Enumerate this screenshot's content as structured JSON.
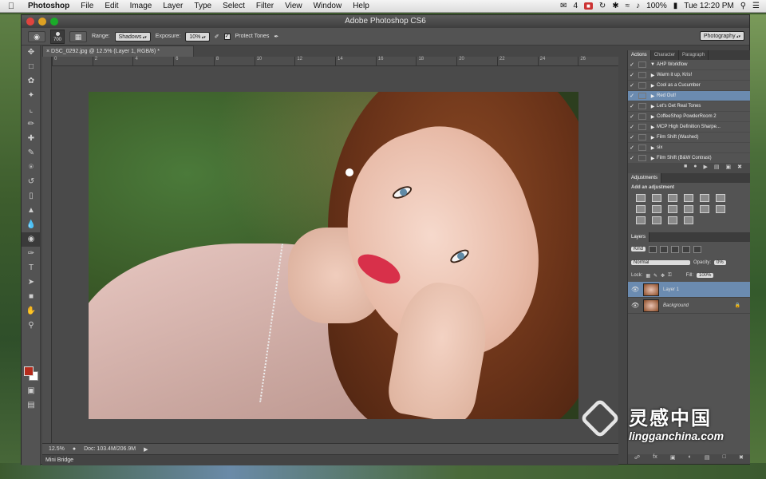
{
  "menubar": {
    "app": "Photoshop",
    "items": [
      "File",
      "Edit",
      "Image",
      "Layer",
      "Type",
      "Select",
      "Filter",
      "View",
      "Window",
      "Help"
    ],
    "status": {
      "count": "4",
      "battery": "100%",
      "clock": "Tue 12:20 PM"
    }
  },
  "window": {
    "title": "Adobe Photoshop CS6"
  },
  "options": {
    "brush_size": "700",
    "range_label": "Range:",
    "range_value": "Shadows",
    "exposure_label": "Exposure:",
    "exposure_value": "10%",
    "protect_tones": "Protect Tones",
    "workspace": "Photography"
  },
  "document": {
    "tab": "DSC_0292.jpg @ 12.5% (Layer 1, RGB/8) *",
    "ruler": [
      "0",
      "2",
      "4",
      "6",
      "8",
      "10",
      "12",
      "14",
      "16",
      "18",
      "20",
      "22",
      "24",
      "26"
    ],
    "zoom": "12.5%",
    "doc_size": "Doc: 103.4M/206.9M"
  },
  "minibridge": "Mini Bridge",
  "actions_panel": {
    "tabs": [
      "Actions",
      "Character",
      "Paragraph"
    ],
    "set": "AHP Workflow",
    "items": [
      "Warm it up, Kris!",
      "Cool as a Cucumber",
      "Red Out!",
      "Let's Get Real Tones",
      "CoffeeShop PowderRoom 2",
      "MCP High Definition Sharpe...",
      "Film Shift (Washed)",
      "six",
      "Film Shift (B&W Contrast)"
    ],
    "selected": "Red Out!"
  },
  "adjustments_panel": {
    "title": "Adjustments",
    "subtitle": "Add an adjustment"
  },
  "layers_panel": {
    "title": "Layers",
    "kind": "Kind",
    "blend_mode": "Normal",
    "opacity_label": "Opacity:",
    "opacity_value": "0%",
    "lock_label": "Lock:",
    "fill_label": "Fill:",
    "fill_value": "100%",
    "layers": [
      {
        "name": "Layer 1",
        "selected": true
      },
      {
        "name": "Background",
        "selected": false
      }
    ]
  },
  "watermark": {
    "brand": "灵感中国",
    "url": "lingganchina.com"
  },
  "colors": {
    "accent_selection": "#6b8bb0",
    "foreground_swatch": "#b42b1c",
    "background_swatch": "#ffffff",
    "chrome": "#535353"
  }
}
